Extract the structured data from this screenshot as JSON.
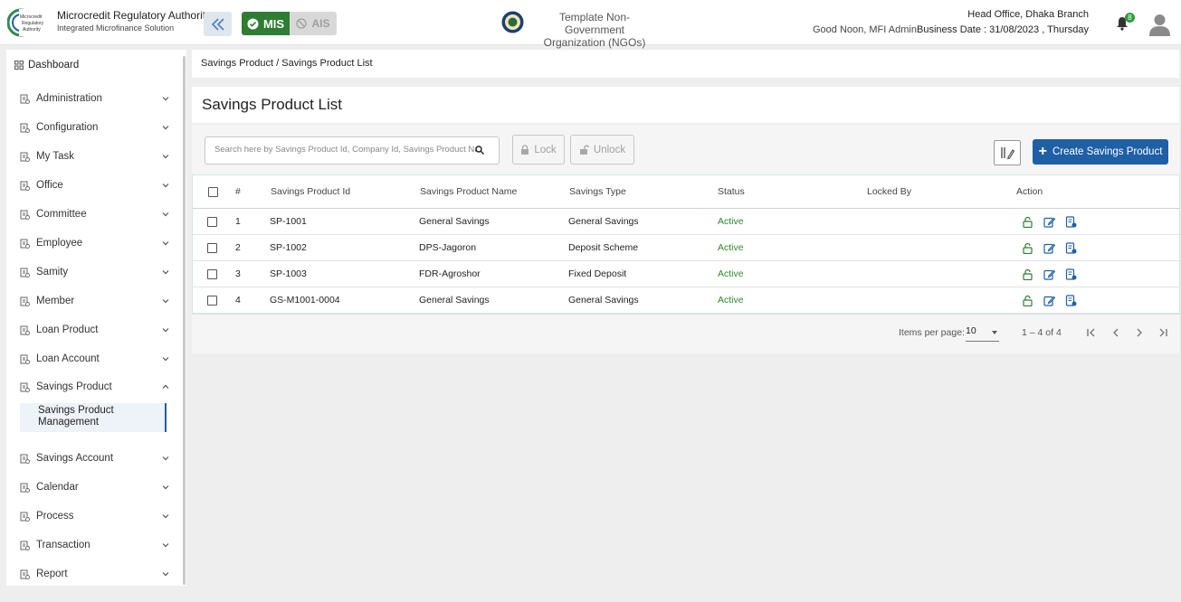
{
  "header": {
    "org_title": "Microcredit Regulatory Authority",
    "org_subtitle": "Integrated Microfinance Solution",
    "mis_label": "MIS",
    "ais_label": "AIS",
    "ngo_line1": "Template Non-Government",
    "ngo_line2": "Organization (NGOs)",
    "greeting": "Good Noon, MFI Admin",
    "branch": "Head Office, Dhaka Branch",
    "business_date": "Business Date : 31/08/2023 , Thursday",
    "notification_count": "8",
    "logo_text": "Microcredit Regulatory Authority"
  },
  "sidebar": {
    "dashboard": "Dashboard",
    "items": [
      {
        "label": "Administration",
        "icon": "admin-icon",
        "expanded": false
      },
      {
        "label": "Configuration",
        "icon": "config-icon",
        "expanded": false
      },
      {
        "label": "My Task",
        "icon": "task-icon",
        "expanded": false
      },
      {
        "label": "Office",
        "icon": "office-icon",
        "expanded": false
      },
      {
        "label": "Committee",
        "icon": "committee-icon",
        "expanded": false
      },
      {
        "label": "Employee",
        "icon": "employee-icon",
        "expanded": false
      },
      {
        "label": "Samity",
        "icon": "samity-icon",
        "expanded": false
      },
      {
        "label": "Member",
        "icon": "member-icon",
        "expanded": false
      },
      {
        "label": "Loan Product",
        "icon": "loan-product-icon",
        "expanded": false
      },
      {
        "label": "Loan Account",
        "icon": "loan-account-icon",
        "expanded": false
      },
      {
        "label": "Savings Product",
        "icon": "savings-product-icon",
        "expanded": true
      },
      {
        "label": "Savings Account",
        "icon": "savings-account-icon",
        "expanded": false
      },
      {
        "label": "Calendar",
        "icon": "calendar-icon",
        "expanded": false
      },
      {
        "label": "Process",
        "icon": "process-icon",
        "expanded": false
      },
      {
        "label": "Transaction",
        "icon": "transaction-icon",
        "expanded": false
      },
      {
        "label": "Report",
        "icon": "report-icon",
        "expanded": false
      }
    ],
    "sub_item": "Savings Product Management"
  },
  "breadcrumb": {
    "parent": "Savings Product",
    "separator": "/",
    "current": "Savings Product List"
  },
  "page": {
    "title": "Savings Product List"
  },
  "toolbar": {
    "search_placeholder": "Search here by Savings Product Id, Company Id, Savings Product Name",
    "lock_label": "Lock",
    "unlock_label": "Unlock",
    "create_label": "Create Savings Product"
  },
  "table": {
    "columns": [
      "#",
      "Savings Product Id",
      "Savings Product Name",
      "Savings Type",
      "Status",
      "Locked By",
      "Action"
    ],
    "rows": [
      {
        "no": "1",
        "id": "SP-1001",
        "name": "General Savings",
        "type": "General Savings",
        "status": "Active",
        "locked_by": ""
      },
      {
        "no": "2",
        "id": "SP-1002",
        "name": "DPS-Jagoron",
        "type": "Deposit Scheme",
        "status": "Active",
        "locked_by": ""
      },
      {
        "no": "3",
        "id": "SP-1003",
        "name": "FDR-Agroshor",
        "type": "Fixed Deposit",
        "status": "Active",
        "locked_by": ""
      },
      {
        "no": "4",
        "id": "GS-M1001-0004",
        "name": "General Savings",
        "type": "General Savings",
        "status": "Active",
        "locked_by": ""
      }
    ]
  },
  "paginator": {
    "items_per_page_label": "Items per page:",
    "items_per_page": "10",
    "range": "1 – 4 of 4"
  },
  "colors": {
    "primary": "#1f5fa6",
    "mis_green": "#2e7d32",
    "active_green": "#2b8a2b"
  }
}
